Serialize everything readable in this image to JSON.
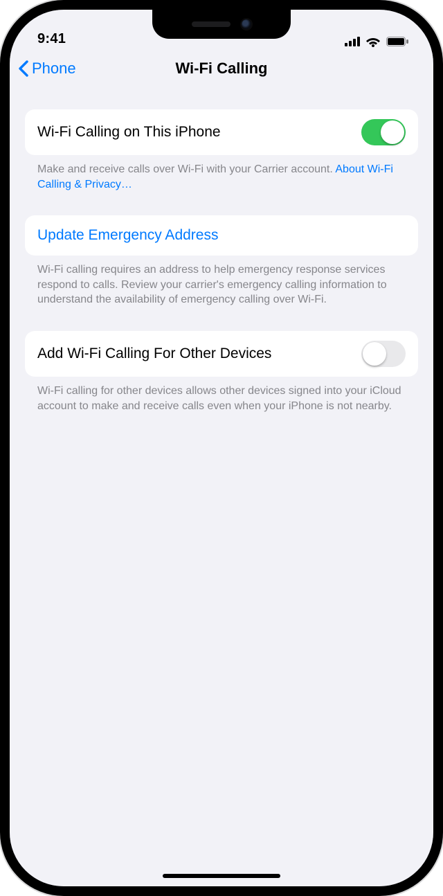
{
  "status": {
    "time": "9:41"
  },
  "nav": {
    "back_label": "Phone",
    "title": "Wi-Fi Calling"
  },
  "groups": {
    "wifi_this_iphone": {
      "label": "Wi-Fi Calling on This iPhone",
      "on": true,
      "footer_text": "Make and receive calls over Wi-Fi with your Carrier account. ",
      "footer_link": "About Wi-Fi Calling & Privacy…"
    },
    "emergency": {
      "label": "Update Emergency Address",
      "footer_text": "Wi-Fi calling requires an address to help emergency response services respond to calls. Review your carrier's emergency calling information to understand the availability of emergency calling over Wi-Fi."
    },
    "other_devices": {
      "label": "Add Wi-Fi Calling For Other Devices",
      "on": false,
      "footer_text": "Wi-Fi calling for other devices allows other devices signed into your iCloud account to make and receive calls even when your iPhone is not nearby."
    }
  }
}
